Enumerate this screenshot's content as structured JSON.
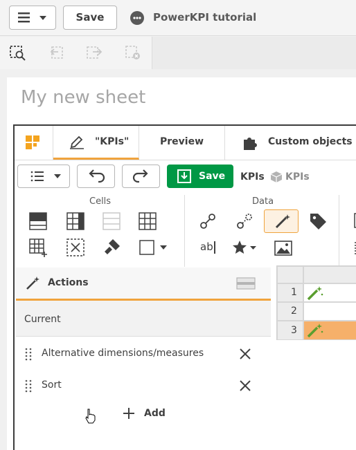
{
  "topbar": {
    "save_label": "Save",
    "app_title": "PowerKPI tutorial",
    "menu_icon": "hamburger-icon"
  },
  "toolbar2": {
    "icons": [
      "smart-select-icon",
      "back-icon",
      "forward-icon",
      "clear-selections-icon"
    ]
  },
  "sheet": {
    "title": "My new sheet"
  },
  "dialog": {
    "tabs": [
      {
        "label": ""
      },
      {
        "label": "\"KPIs\""
      },
      {
        "label": "Preview"
      },
      {
        "label": "Custom objects"
      }
    ],
    "toolbar": {
      "save_label": "Save",
      "breadcrumb_parent": "KPIs",
      "breadcrumb_child": "KPIs"
    },
    "ribbon": {
      "cells_label": "Cells",
      "data_label": "Data",
      "ab_label": "ab"
    },
    "actions": {
      "title": "Actions",
      "current_label": "Current",
      "items": [
        {
          "label": "Alternative dimensions/measures"
        },
        {
          "label": "Sort"
        }
      ],
      "add_label": "Add"
    },
    "grid": {
      "rows": [
        "1",
        "2",
        "3"
      ],
      "selected_row": "3"
    }
  },
  "colors": {
    "accent_orange": "#f0a33c",
    "save_green": "#009845",
    "qlik_orange": "#f4a41f"
  }
}
